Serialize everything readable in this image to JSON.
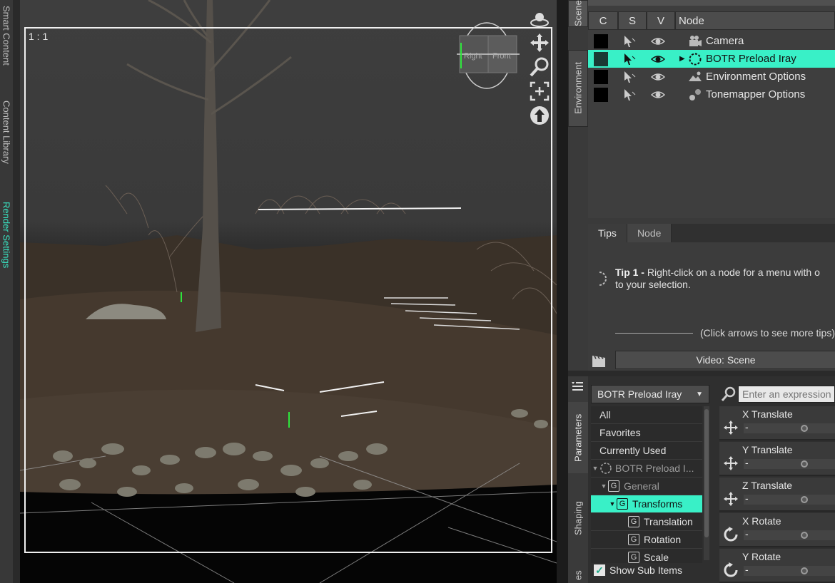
{
  "left_tabs": [
    {
      "label": "Smart Content",
      "active": false
    },
    {
      "label": "Content Library",
      "active": false
    },
    {
      "label": "Render Settings",
      "active": true
    }
  ],
  "viewport": {
    "ratio_label": "1 : 1",
    "cube_faces": [
      "Right",
      "Front"
    ]
  },
  "scene_tabs": [
    "Scene",
    "Environment"
  ],
  "scene": {
    "columns": [
      "C",
      "S",
      "V",
      "Node"
    ],
    "rows": [
      {
        "label": "Camera",
        "icon": "camera-icon",
        "selected": false,
        "expandable": false
      },
      {
        "label": "BOTR Preload Iray",
        "icon": "group-node-icon",
        "selected": true,
        "expandable": true
      },
      {
        "label": "Environment Options",
        "icon": "environment-icon",
        "selected": false,
        "expandable": false
      },
      {
        "label": "Tonemapper Options",
        "icon": "tonemapper-icon",
        "selected": false,
        "expandable": false
      }
    ]
  },
  "tips": {
    "tabs": [
      "Tips",
      "Node"
    ],
    "active_tab": "Tips",
    "tip_title": "Tip 1 -",
    "tip_body_line1": "Right-click on a node for a menu with o",
    "tip_body_line2": "to your selection.",
    "more_label": "(Click arrows to see more tips)",
    "video_button": "Video: Scene"
  },
  "param_tabs": [
    "Parameters",
    "Shaping",
    "es"
  ],
  "parameters": {
    "node_dropdown": "BOTR Preload Iray",
    "search_placeholder": "Enter an expression",
    "tree": [
      {
        "label": "All",
        "level": 0,
        "dim": false,
        "selected": false,
        "icon": false,
        "arrow": ""
      },
      {
        "label": "Favorites",
        "level": 0,
        "dim": false,
        "selected": false,
        "icon": false,
        "arrow": ""
      },
      {
        "label": "Currently Used",
        "level": 0,
        "dim": false,
        "selected": false,
        "icon": false,
        "arrow": ""
      },
      {
        "label": "BOTR Preload I...",
        "level": 0,
        "dim": true,
        "selected": false,
        "icon": "node",
        "arrow": "▼"
      },
      {
        "label": "General",
        "level": 1,
        "dim": true,
        "selected": false,
        "icon": "G",
        "arrow": "▼"
      },
      {
        "label": "Transforms",
        "level": 2,
        "dim": false,
        "selected": true,
        "icon": "G",
        "arrow": "▼"
      },
      {
        "label": "Translation",
        "level": 3,
        "dim": false,
        "selected": false,
        "icon": "G",
        "arrow": ""
      },
      {
        "label": "Rotation",
        "level": 3,
        "dim": false,
        "selected": false,
        "icon": "G",
        "arrow": ""
      },
      {
        "label": "Scale",
        "level": 3,
        "dim": false,
        "selected": false,
        "icon": "G",
        "arrow": ""
      }
    ],
    "show_sub_items": {
      "label": "Show Sub Items",
      "checked": true
    },
    "properties": [
      {
        "name": "X Translate",
        "value": "-",
        "icon": "translate-icon"
      },
      {
        "name": "Y Translate",
        "value": "-",
        "icon": "translate-icon"
      },
      {
        "name": "Z Translate",
        "value": "-",
        "icon": "translate-icon"
      },
      {
        "name": "X Rotate",
        "value": "-",
        "icon": "rotate-icon"
      },
      {
        "name": "Y Rotate",
        "value": "-",
        "icon": "rotate-icon"
      }
    ]
  },
  "colors": {
    "accent": "#39f0c7",
    "panel": "#3e3e3e",
    "viewport_bg": "#3a3a3a"
  }
}
